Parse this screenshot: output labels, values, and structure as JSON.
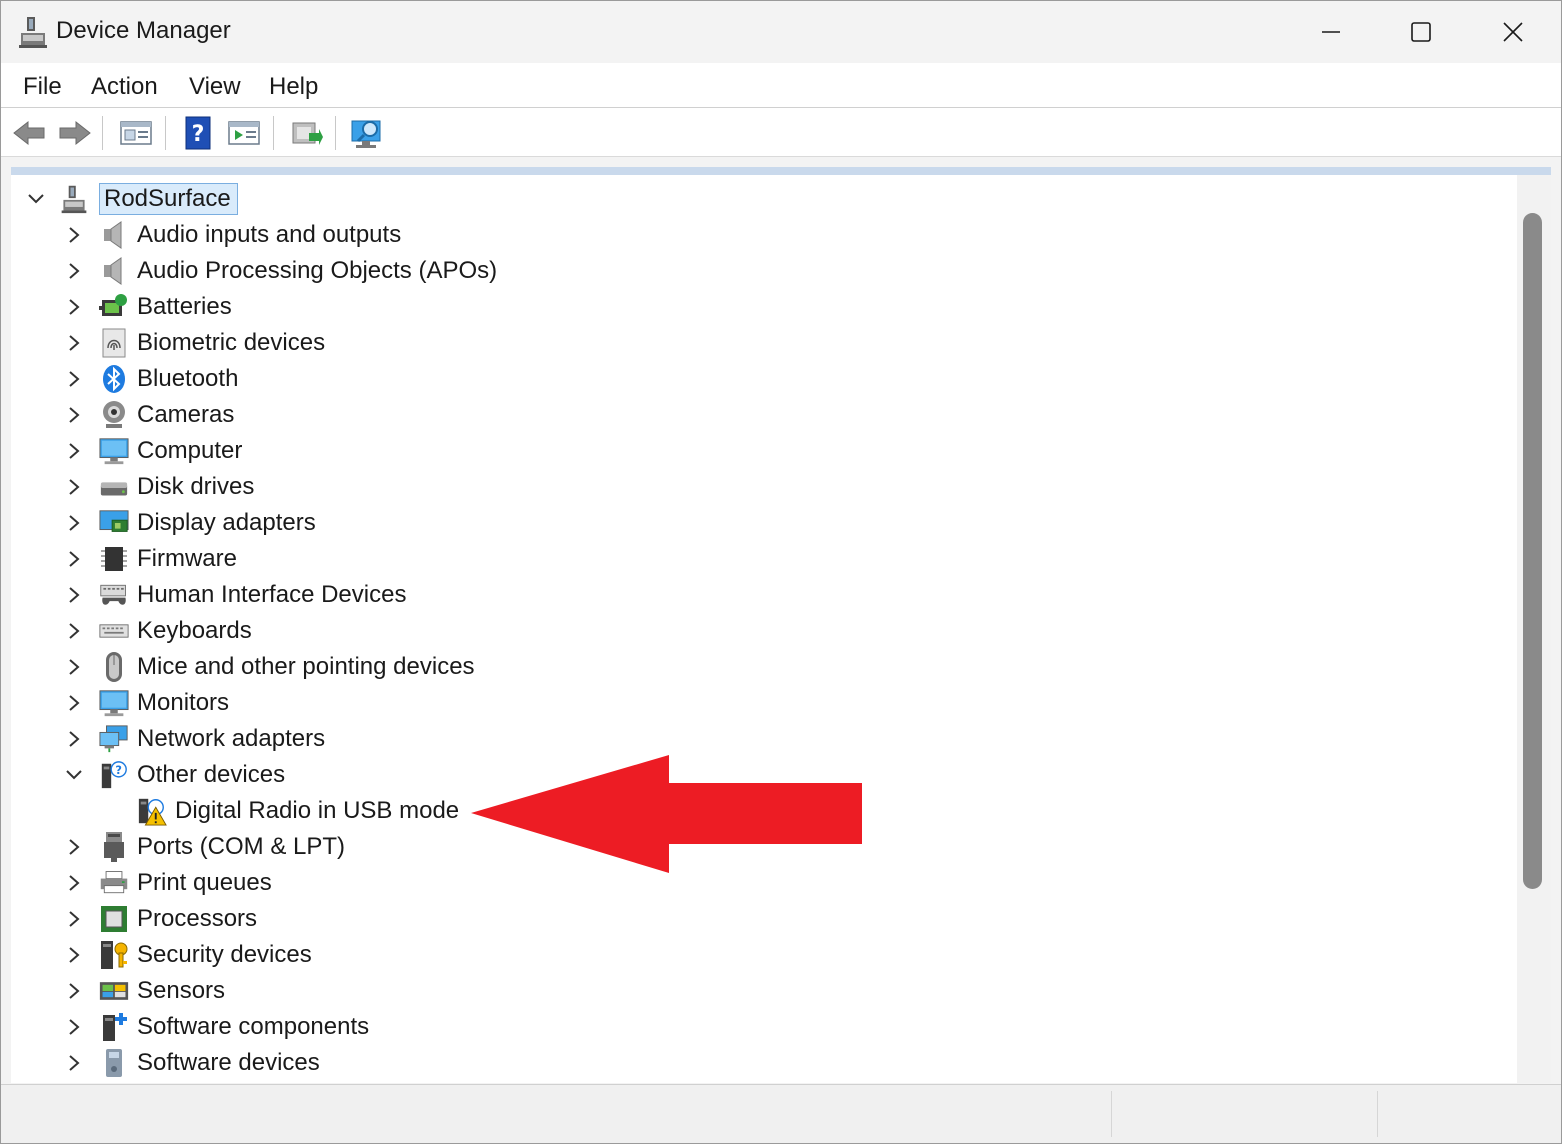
{
  "window": {
    "title": "Device Manager"
  },
  "menu": [
    "File",
    "Action",
    "View",
    "Help"
  ],
  "toolbar": [
    "back-icon",
    "forward-icon",
    "properties-icon",
    "help-icon",
    "run-icon",
    "update-driver-icon",
    "scan-hardware-icon"
  ],
  "tree": {
    "root": "RodSurface",
    "categories": [
      {
        "label": "Audio inputs and outputs",
        "icon": "speaker-icon",
        "expanded": false
      },
      {
        "label": "Audio Processing Objects (APOs)",
        "icon": "speaker-icon",
        "expanded": false
      },
      {
        "label": "Batteries",
        "icon": "battery-icon",
        "expanded": false
      },
      {
        "label": "Biometric devices",
        "icon": "fingerprint-icon",
        "expanded": false
      },
      {
        "label": "Bluetooth",
        "icon": "bluetooth-icon",
        "expanded": false
      },
      {
        "label": "Cameras",
        "icon": "camera-icon",
        "expanded": false
      },
      {
        "label": "Computer",
        "icon": "computer-icon",
        "expanded": false
      },
      {
        "label": "Disk drives",
        "icon": "disk-icon",
        "expanded": false
      },
      {
        "label": "Display adapters",
        "icon": "display-adapter-icon",
        "expanded": false
      },
      {
        "label": "Firmware",
        "icon": "chip-icon",
        "expanded": false
      },
      {
        "label": "Human Interface Devices",
        "icon": "hid-icon",
        "expanded": false
      },
      {
        "label": "Keyboards",
        "icon": "keyboard-icon",
        "expanded": false
      },
      {
        "label": "Mice and other pointing devices",
        "icon": "mouse-icon",
        "expanded": false
      },
      {
        "label": "Monitors",
        "icon": "monitor-icon",
        "expanded": false
      },
      {
        "label": "Network adapters",
        "icon": "network-icon",
        "expanded": false
      },
      {
        "label": "Other devices",
        "icon": "unknown-device-icon",
        "expanded": true
      },
      {
        "label": "Digital Radio in USB mode",
        "icon": "warning-device-icon",
        "child": true
      },
      {
        "label": "Ports (COM & LPT)",
        "icon": "port-icon",
        "expanded": false
      },
      {
        "label": "Print queues",
        "icon": "printer-icon",
        "expanded": false
      },
      {
        "label": "Processors",
        "icon": "processor-icon",
        "expanded": false
      },
      {
        "label": "Security devices",
        "icon": "security-icon",
        "expanded": false
      },
      {
        "label": "Sensors",
        "icon": "sensor-icon",
        "expanded": false
      },
      {
        "label": "Software components",
        "icon": "software-component-icon",
        "expanded": false
      },
      {
        "label": "Software devices",
        "icon": "software-device-icon",
        "expanded": false
      }
    ]
  },
  "annotation": {
    "arrow_color": "#ed1c24"
  }
}
